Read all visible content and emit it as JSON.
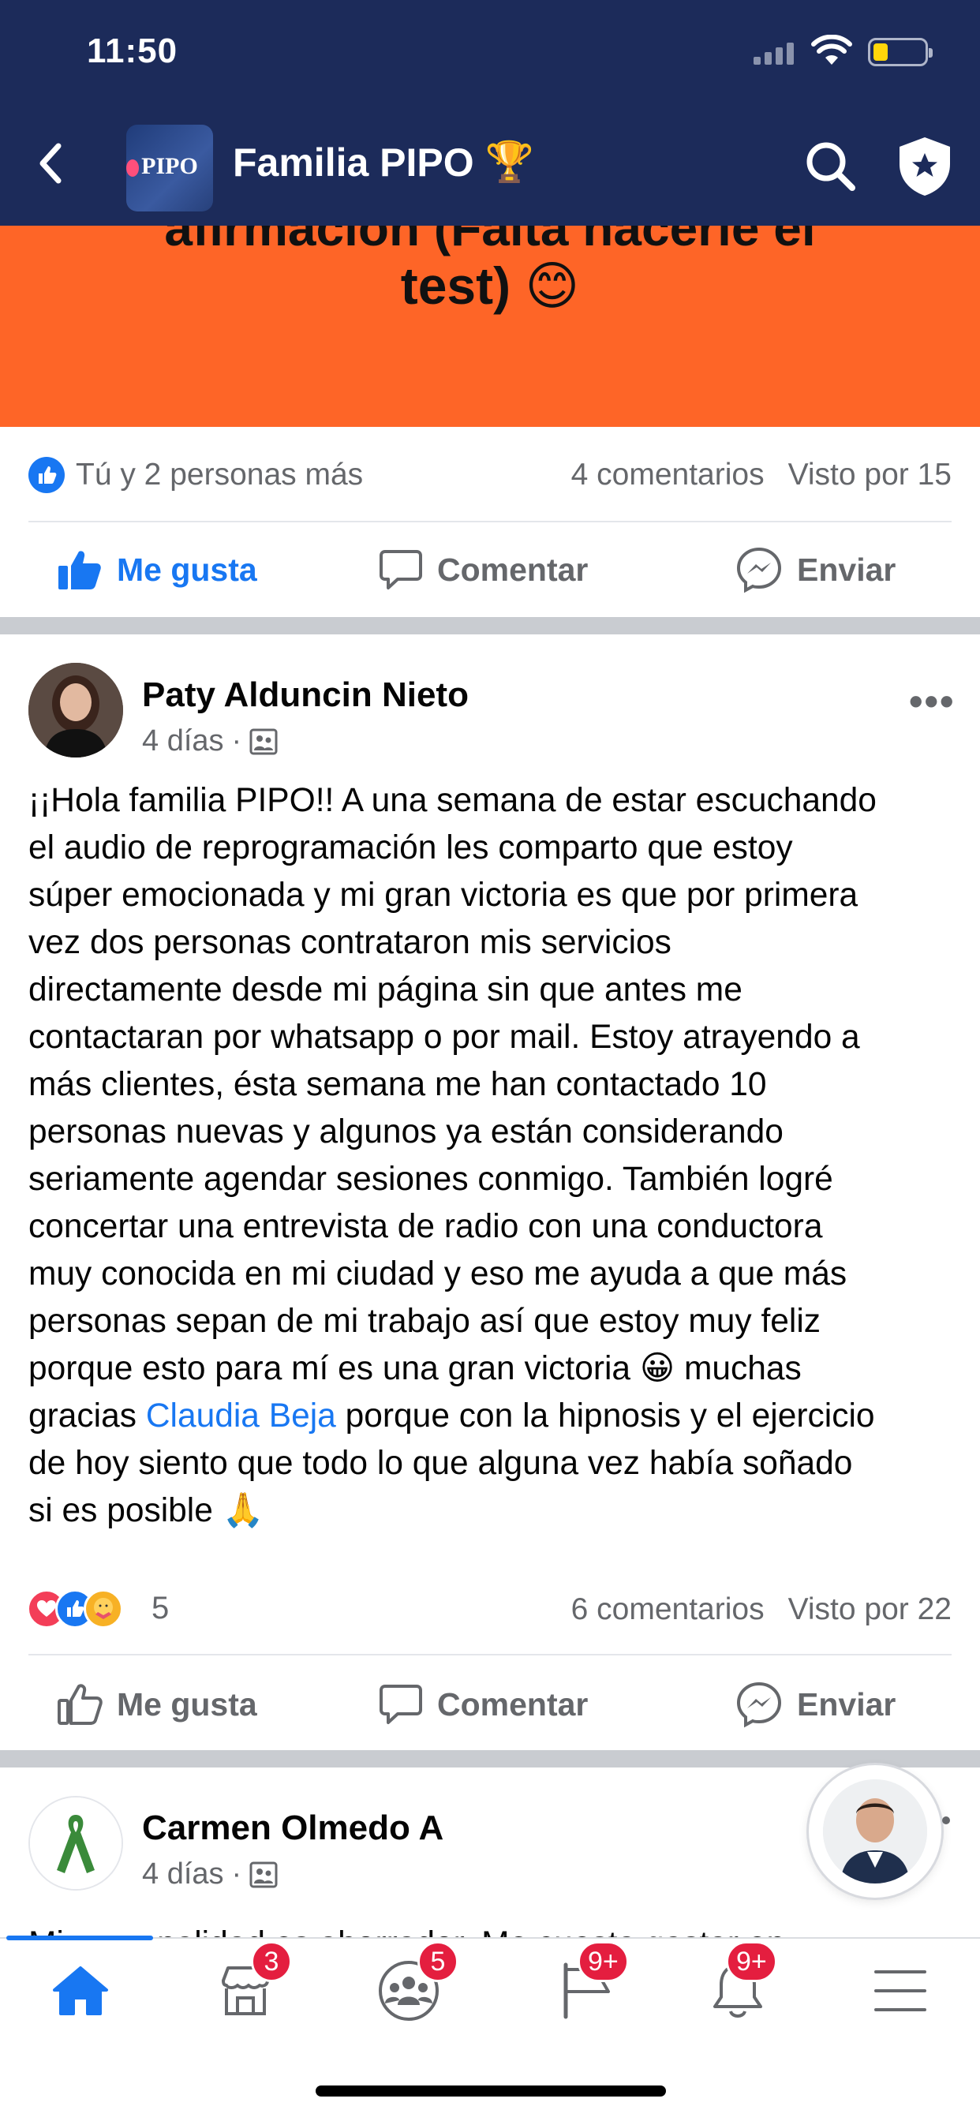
{
  "status_bar": {
    "time": "11:50"
  },
  "header": {
    "group_name": "Familia PIPO",
    "group_logo_text": "PIPO",
    "title_emoji": "🏆"
  },
  "top_post": {
    "text_cut_line": "afirmación (Falta hacerle el",
    "text_line": "test) 😊",
    "reactions_summary": "Tú y 2 personas más",
    "comments": "4 comentarios",
    "seen_by": "Visto por 15",
    "background_color": "#fe6527"
  },
  "actions": {
    "like": "Me gusta",
    "comment": "Comentar",
    "send": "Enviar"
  },
  "post": {
    "author": "Paty Alduncin Nieto",
    "time": "4 días",
    "text_part1": "¡¡Hola familia PIPO!! A una semana de estar escuchando\nel audio de reprogramación les comparto que estoy\nsúper emocionada y mi gran victoria es que por primera\nvez dos personas contrataron mis servicios\ndirectamente desde mi página sin que antes me\ncontactaran por whatsapp o por mail.  Estoy atrayendo a\nmás clientes, ésta semana me han contactado 10\npersonas nuevas y algunos ya están considerando\nseriamente agendar sesiones conmigo. También logré\nconcertar una entrevista de radio con una conductora\nmuy conocida en mi ciudad y eso me ayuda a que más\npersonas sepan de mi trabajo así que estoy muy feliz\nporque esto para mí es una gran victoria 😀 muchas\ngracias ",
    "mention": "Claudia Beja",
    "text_part2": " porque con la hipnosis y el ejercicio\nde hoy siento que todo lo que alguna vez había soñado\nsi es posible 🙏",
    "reaction_count": "5",
    "comments": "6 comentarios",
    "seen_by": "Visto por 22"
  },
  "next_post": {
    "author": "Carmen Olmedo A",
    "time": "4 días",
    "clipped_text": "Mi personalidad es ahorrador. Me cuesta gastar en"
  },
  "tabbar": {
    "badges": {
      "marketplace": "3",
      "groups": "5",
      "pages": "9+",
      "notifications": "9+"
    }
  },
  "colors": {
    "header_bg": "#1c2b5a",
    "accent": "#1877f2",
    "badge": "#e41e3f"
  }
}
